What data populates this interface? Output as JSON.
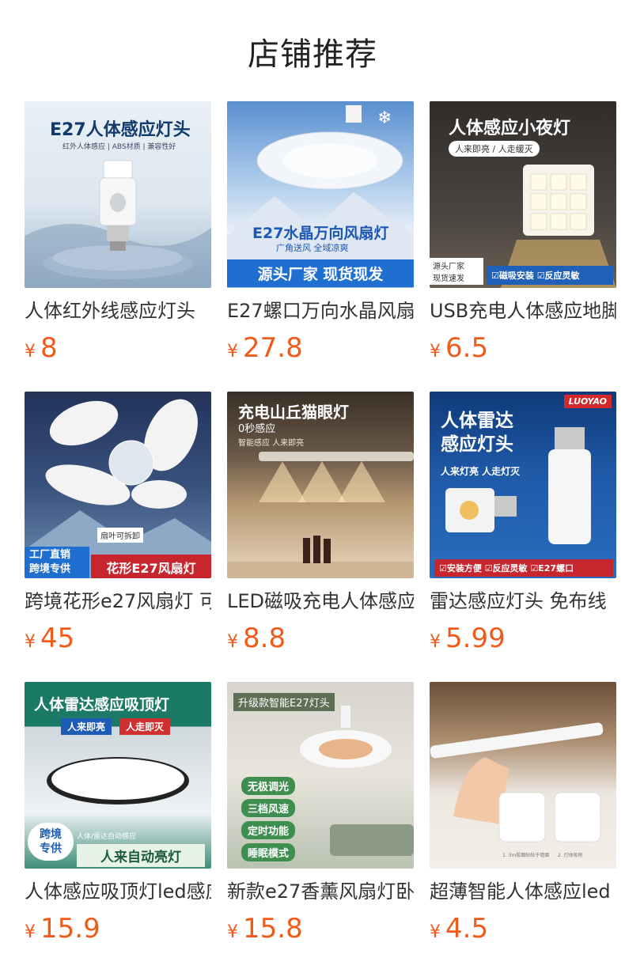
{
  "page": {
    "title": "店铺推荐"
  },
  "products": [
    {
      "name": "人体红外线感应灯头",
      "currency": "¥",
      "price": "8",
      "image": {
        "headline": "E27人体感应灯头",
        "sub": "红外人体感应 | ABS材质 | 兼容性好"
      }
    },
    {
      "name": "E27螺口万向水晶风扇",
      "currency": "¥",
      "price": "27.8",
      "image": {
        "headline": "E27水晶万向风扇灯",
        "sub": "广角送风 全域凉爽",
        "banner": "源头厂家 现货现发"
      }
    },
    {
      "name": "USB充电人体感应地脚",
      "currency": "¥",
      "price": "6.5",
      "image": {
        "headline": "人体感应小夜灯",
        "sub": "人来即亮 / 人走缓灭",
        "corner": "源头厂家\n现货速发",
        "tags": "☑磁吸安装 ☑反应灵敏"
      }
    },
    {
      "name": "跨境花形e27风扇灯 可",
      "currency": "¥",
      "price": "45",
      "image": {
        "label": "扇叶可拆卸",
        "corner": "工厂直销\n跨境专供",
        "banner": "花形E27风扇灯"
      }
    },
    {
      "name": "LED磁吸充电人体感应",
      "currency": "¥",
      "price": "8.8",
      "image": {
        "headline": "充电山丘猫眼灯",
        "sub": "0秒感应",
        "sub2": "智能感应 人来即亮"
      }
    },
    {
      "name": "雷达感应灯头 免布线",
      "currency": "¥",
      "price": "5.99",
      "image": {
        "brand": "LUOYAO",
        "headline": "人体雷达\n感应灯头",
        "sub": "人来灯亮 人走灯灭",
        "tags": "☑安装方便 ☑反应灵敏 ☑E27螺口"
      }
    },
    {
      "name": "人体感应吸顶灯led感应",
      "currency": "¥",
      "price": "15.9",
      "image": {
        "headline": "人体雷达感应吸顶灯",
        "pill1": "人来即亮",
        "pill2": "人走即灭",
        "corner": "跨境\n专供",
        "small": "人体/雷达自动感应",
        "banner": "人来自动亮灯"
      }
    },
    {
      "name": "新款e27香薰风扇灯卧室",
      "currency": "¥",
      "price": "15.8",
      "image": {
        "headline": "升级款智能E27灯头",
        "f1": "无极调光",
        "f2": "三档风速",
        "f3": "定时功能",
        "f4": "睡眠模式"
      }
    },
    {
      "name": "超薄智能人体感应led",
      "currency": "¥",
      "price": "4.5",
      "image": {
        "cap1": "1. 3m胶面贴贴于墙面",
        "cap2": "2. 灯体吸附"
      }
    }
  ]
}
